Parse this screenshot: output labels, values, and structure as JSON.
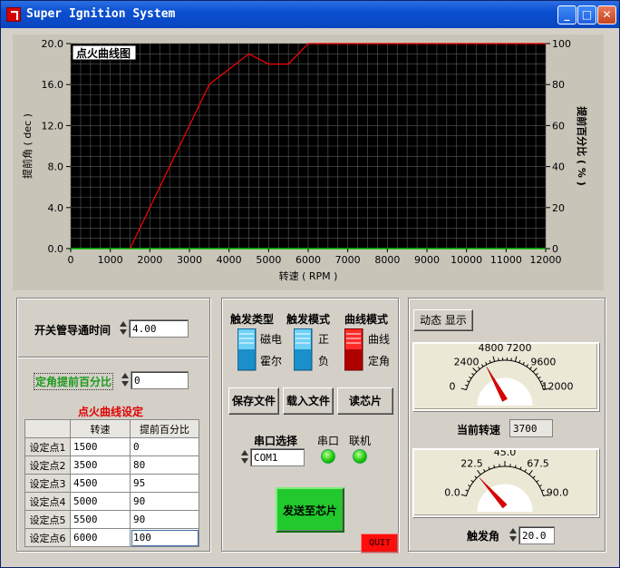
{
  "window": {
    "title": "Super Ignition System"
  },
  "chart_data": {
    "type": "line",
    "title": "点火曲线图",
    "xlabel": "转速 ( RPM )",
    "ylabel_left": "提前角 ( dec )",
    "ylabel_right": "提前百分比 ( % )",
    "xlim": [
      0,
      12000
    ],
    "ylim_left": [
      0,
      20
    ],
    "ylim_right": [
      0,
      100
    ],
    "xticks": [
      "0",
      "1000",
      "2000",
      "3000",
      "4000",
      "5000",
      "6000",
      "7000",
      "8000",
      "9000",
      "10000",
      "11000",
      "12000"
    ],
    "yticks_left": [
      "0.0",
      "4.0",
      "8.0",
      "12.0",
      "16.0",
      "20.0"
    ],
    "yticks_right": [
      "0",
      "20",
      "40",
      "60",
      "80",
      "100"
    ],
    "grid": true,
    "series": [
      {
        "name": "",
        "color": "#ff0000",
        "x": [
          1500,
          3500,
          4500,
          5000,
          5500,
          6000,
          12000
        ],
        "y": [
          0,
          80,
          95,
          90,
          90,
          100,
          100
        ]
      }
    ]
  },
  "left": {
    "dwell_label": "开关管导通时间",
    "dwell_value": "4.00",
    "fixed_label": "定角提前百分比",
    "fixed_value": "0",
    "table_title": "点火曲线设定",
    "col_rpm": "转速",
    "col_pct": "提前百分比",
    "rows": [
      {
        "name": "设定点1",
        "rpm": "1500",
        "pct": "0"
      },
      {
        "name": "设定点2",
        "rpm": "3500",
        "pct": "80"
      },
      {
        "name": "设定点3",
        "rpm": "4500",
        "pct": "95"
      },
      {
        "name": "设定点4",
        "rpm": "5000",
        "pct": "90"
      },
      {
        "name": "设定点5",
        "rpm": "5500",
        "pct": "90"
      },
      {
        "name": "设定点6",
        "rpm": "6000",
        "pct": "100"
      }
    ]
  },
  "middle": {
    "trig_type": "触发类型",
    "trig_mode": "触发模式",
    "curve_mode": "曲线模式",
    "magnet": "磁电",
    "hall": "霍尔",
    "pos": "正",
    "neg": "负",
    "curve": "曲线",
    "fixed": "定角",
    "save_btn": "保存文件",
    "load_btn": "载入文件",
    "read_btn": "读芯片",
    "port_label": "串口选择",
    "port_value": "COM1",
    "serial_label": "串口",
    "online_label": "联机",
    "send_btn": "发送至芯片",
    "quit_btn": "QUIT"
  },
  "right": {
    "dynamic_btn": "动态 显示",
    "rpm_ticks": [
      "0",
      "2400",
      "4800",
      "7200",
      "9600",
      "12000"
    ],
    "rpm_label": "当前转速",
    "rpm_value": "3700",
    "rpm_current": 3700,
    "angle_ticks": [
      "0.0",
      "22.5",
      "45.0",
      "67.5",
      "90.0"
    ],
    "angle_label": "触发角",
    "angle_value": "20.0",
    "angle_current": 20
  }
}
